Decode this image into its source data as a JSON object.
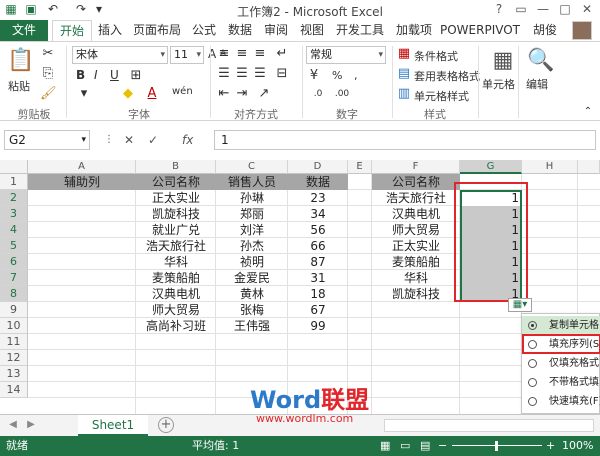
{
  "window": {
    "title": "工作簿2 - Microsoft Excel",
    "help": "?",
    "user": "胡俊"
  },
  "tabs": [
    "开始",
    "插入",
    "页面布局",
    "公式",
    "数据",
    "审阅",
    "视图",
    "开发工具",
    "加载项",
    "POWERPIVOT"
  ],
  "file_tab": "文件",
  "active_tab": "开始",
  "ribbon": {
    "clipboard": {
      "label": "剪贴板",
      "paste": "粘贴"
    },
    "font": {
      "label": "字体",
      "name": "宋体",
      "size": "11",
      "bold": "B",
      "italic": "I",
      "underline": "U",
      "grow": "A",
      "shrink": "A",
      "wen": "wén"
    },
    "align": {
      "label": "对齐方式"
    },
    "number": {
      "label": "数字",
      "format": "常规",
      "percent": "%",
      "comma": ","
    },
    "styles": {
      "label": "样式",
      "conditional": "条件格式",
      "table": "套用表格格式",
      "cell": "单元格样式"
    },
    "cells": {
      "label": "单元格"
    },
    "editing": {
      "label": "编辑"
    }
  },
  "formula_bar": {
    "name_box": "G2",
    "fx": "fx",
    "value": "1"
  },
  "columns": [
    "A",
    "B",
    "C",
    "D",
    "E",
    "F",
    "G",
    "H"
  ],
  "rows": [
    "1",
    "2",
    "3",
    "4",
    "5",
    "6",
    "7",
    "8",
    "9",
    "10",
    "11",
    "12",
    "13",
    "14"
  ],
  "header_row": {
    "a": "辅助列",
    "b": "公司名称",
    "c": "销售人员",
    "d": "数据",
    "f": "公司名称"
  },
  "table_rows": [
    {
      "company": "正太实业",
      "person": "孙琳",
      "value": "23"
    },
    {
      "company": "凯旋科技",
      "person": "郑丽",
      "value": "34"
    },
    {
      "company": "就业广兑",
      "person": "刘洋",
      "value": "56"
    },
    {
      "company": "浩天旅行社",
      "person": "孙杰",
      "value": "66"
    },
    {
      "company": "华科",
      "person": "祯明",
      "value": "87"
    },
    {
      "company": "麦策船舶",
      "person": "金爱民",
      "value": "31"
    },
    {
      "company": "汉典电机",
      "person": "黄林",
      "value": "18"
    },
    {
      "company": "师大贸易",
      "person": "张梅",
      "value": "67"
    },
    {
      "company": "高尚补习班",
      "person": "王伟强",
      "value": "99"
    }
  ],
  "f_list": [
    "浩天旅行社",
    "汉典电机",
    "师大贸易",
    "正太实业",
    "麦策船舶",
    "华科",
    "凯旋科技"
  ],
  "g_values": [
    "1",
    "1",
    "1",
    "1",
    "1",
    "1",
    "1"
  ],
  "autofill_menu": {
    "items": [
      "复制单元格",
      "填充序列(S)",
      "仅填充格式",
      "不带格式填",
      "快速填充(F)"
    ],
    "selected_index": 1
  },
  "sheet_tab": "Sheet1",
  "status": {
    "ready": "就绪",
    "average": "平均值: 1",
    "zoom": "100%"
  },
  "watermark": {
    "word": "Word",
    "lianmeng": "联盟",
    "url": "www.wordlm.com"
  },
  "colors": {
    "excel_green": "#217346",
    "highlight": "#e0262a",
    "header_fill": "#a6a6a6",
    "selection_fill": "#c9c9c9"
  }
}
